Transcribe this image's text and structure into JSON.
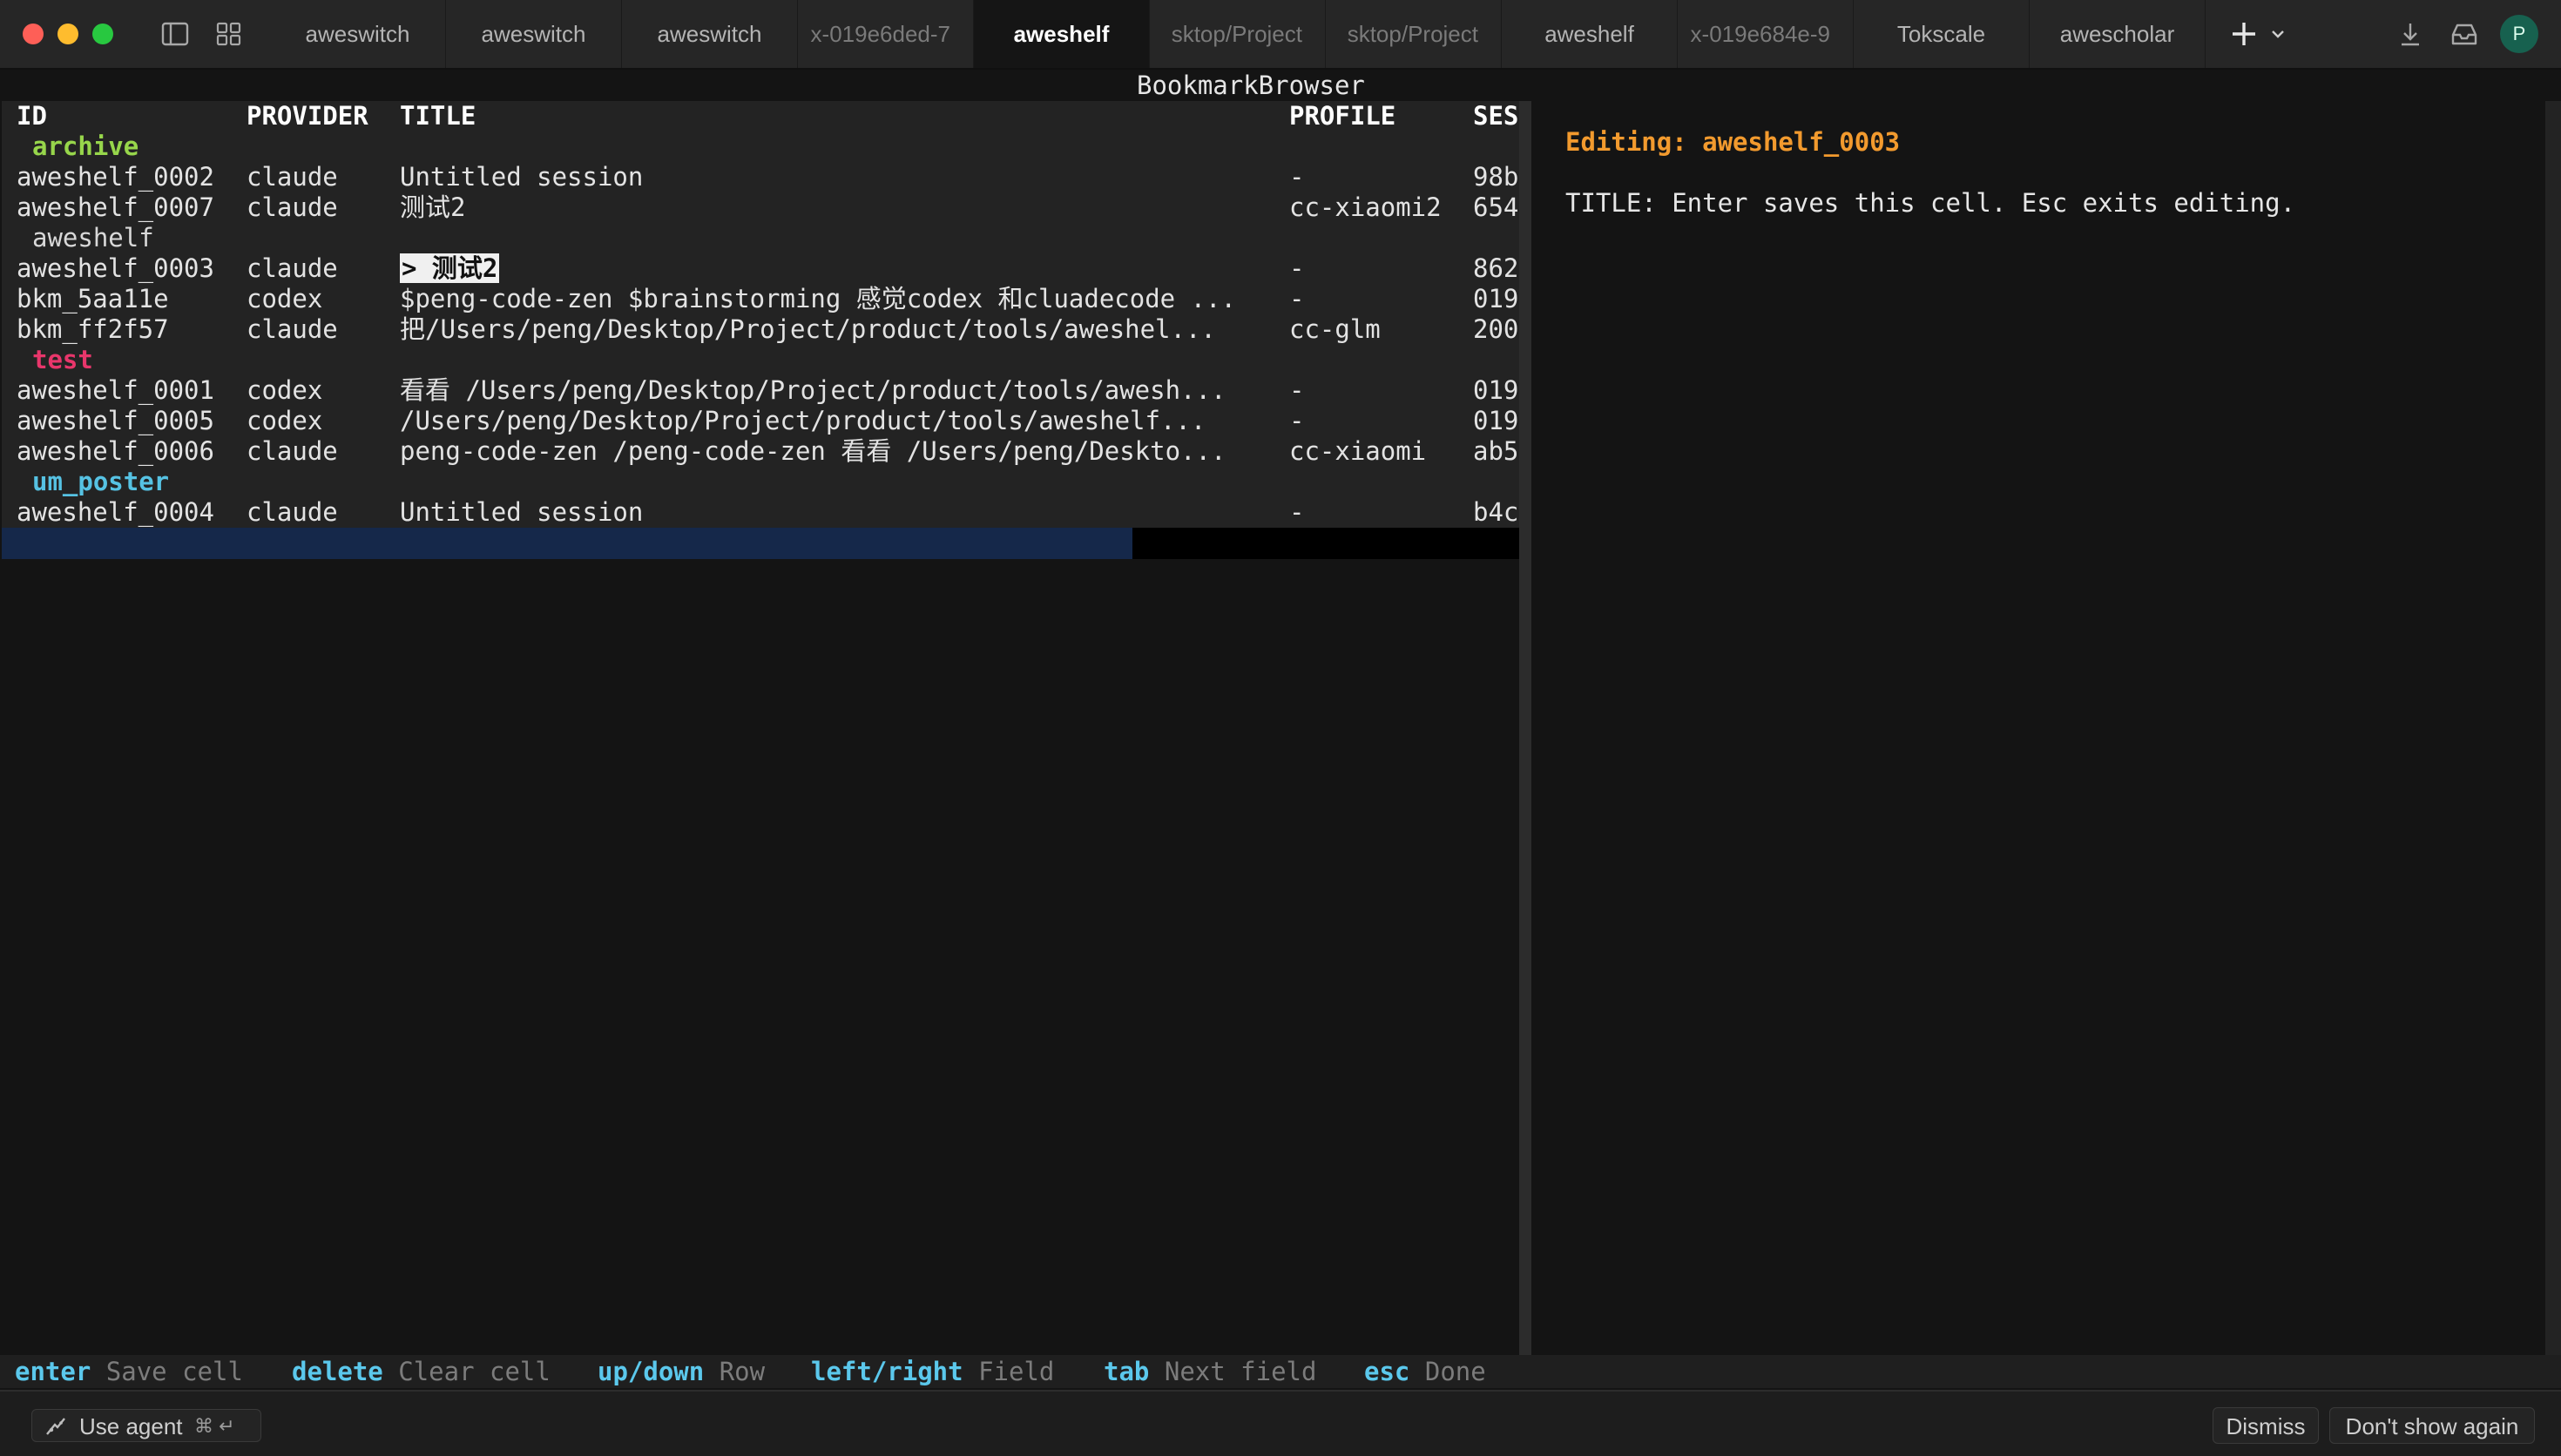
{
  "window": {
    "tabs": [
      {
        "label": "aweswitch",
        "state": "normal"
      },
      {
        "label": "aweswitch",
        "state": "normal"
      },
      {
        "label": "aweswitch",
        "state": "normal"
      },
      {
        "label": "x-019e6ded-7",
        "state": "faded"
      },
      {
        "label": "aweshelf",
        "state": "active"
      },
      {
        "label": "sktop/Project",
        "state": "faded"
      },
      {
        "label": "sktop/Project",
        "state": "faded"
      },
      {
        "label": "aweshelf",
        "state": "normal"
      },
      {
        "label": "x-019e684e-9",
        "state": "faded"
      },
      {
        "label": "Tokscale",
        "state": "normal"
      },
      {
        "label": "awescholar",
        "state": "normal"
      }
    ],
    "avatar_initial": "P"
  },
  "app": {
    "title": "BookmarkBrowser",
    "columns": {
      "id": "ID",
      "provider": "PROVIDER",
      "title": "TITLE",
      "profile": "PROFILE",
      "session": "SES"
    },
    "groups": [
      {
        "name": "archive",
        "color": "#97d64b",
        "rows": [
          {
            "id": "aweshelf_0002",
            "provider": "claude",
            "title": "Untitled session",
            "profile": "-",
            "session": "98b"
          },
          {
            "id": "aweshelf_0007",
            "provider": "claude",
            "title": "测试2",
            "profile": "cc-xiaomi2",
            "session": "654"
          }
        ]
      },
      {
        "name": "aweshelf",
        "color": "#d8d8d8",
        "rows": [
          {
            "id": "aweshelf_0003",
            "provider": "claude",
            "title": "> 测试2",
            "profile": "-",
            "session": "862",
            "editing": true
          },
          {
            "id": "bkm_5aa11e",
            "provider": "codex",
            "title": "$peng-code-zen $brainstorming 感觉codex 和cluadecode ...",
            "profile": "-",
            "session": "019"
          },
          {
            "id": "bkm_ff2f57",
            "provider": "claude",
            "title": "把/Users/peng/Desktop/Project/product/tools/aweshel...",
            "profile": "cc-glm",
            "session": "200"
          }
        ]
      },
      {
        "name": "test",
        "color": "#e8366b",
        "rows": [
          {
            "id": "aweshelf_0001",
            "provider": "codex",
            "title": "看看 /Users/peng/Desktop/Project/product/tools/awesh...",
            "profile": "-",
            "session": "019"
          },
          {
            "id": "aweshelf_0005",
            "provider": "codex",
            "title": "/Users/peng/Desktop/Project/product/tools/aweshelf...",
            "profile": "-",
            "session": "019"
          },
          {
            "id": "aweshelf_0006",
            "provider": "claude",
            "title": "peng-code-zen /peng-code-zen 看看 /Users/peng/Deskto...",
            "profile": "cc-xiaomi",
            "session": "ab5"
          }
        ]
      },
      {
        "name": "um_poster",
        "color": "#56c2e3",
        "rows": [
          {
            "id": "aweshelf_0004",
            "provider": "claude",
            "title": "Untitled session",
            "profile": "-",
            "session": "b4c"
          }
        ]
      }
    ],
    "editor": {
      "heading": "Editing: aweshelf_0003",
      "hint": "TITLE: Enter saves this cell. Esc exits editing."
    },
    "keybar": [
      {
        "key": "enter",
        "desc": "Save cell"
      },
      {
        "key": "delete",
        "desc": "Clear cell"
      },
      {
        "key": "up/down",
        "desc": "Row"
      },
      {
        "key": "left/right",
        "desc": "Field"
      },
      {
        "key": "tab",
        "desc": "Next field"
      },
      {
        "key": "esc",
        "desc": "Done"
      }
    ]
  },
  "bottombar": {
    "agent_label": "Use agent",
    "agent_shortcut": "⌘ ↵",
    "dismiss_label": "Dismiss",
    "dont_show_label": "Don't show again"
  }
}
